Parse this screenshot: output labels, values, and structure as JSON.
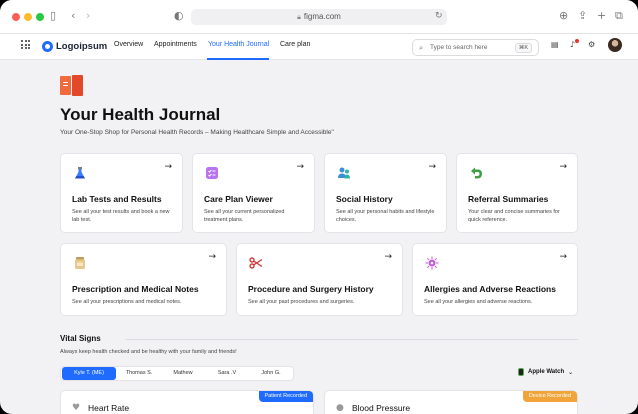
{
  "browser": {
    "url": "figma.com",
    "lock_icon": "lock-icon",
    "colors": {
      "close": "#ff5f57",
      "minimize": "#febc2e",
      "maximize": "#28c840"
    }
  },
  "nav": {
    "logo_text": "Logoipsum",
    "items": [
      {
        "label": "Overview"
      },
      {
        "label": "Appointments"
      },
      {
        "label": "Your Health Journal",
        "active": true
      },
      {
        "label": "Care plan"
      }
    ],
    "search_placeholder": "Type to search here",
    "search_shortcut": "⌘K",
    "accent": "#1f6bff"
  },
  "header": {
    "title": "Your Health Journal",
    "subtitle": "Your One-Stop Shop for Personal Health Records – Making Healthcare Simple and Accessible\""
  },
  "cards": [
    {
      "title": "Lab Tests and Results",
      "desc": "See all your test results and book a new lab test.",
      "icon": "flask-icon"
    },
    {
      "title": "Care Plan Viewer",
      "desc": "See all your current personalized treatment plans.",
      "icon": "checklist-icon"
    },
    {
      "title": "Social History",
      "desc": "See all your personal habits and lifestyle choices.",
      "icon": "people-icon"
    },
    {
      "title": "Referral Summaries",
      "desc": "Your clear and concise summaries for quick reference.",
      "icon": "referral-arrow-icon"
    },
    {
      "title": "Prescription and Medical Notes",
      "desc": "See all your prescriptions and medical notes.",
      "icon": "pill-bottle-icon"
    },
    {
      "title": "Procedure and Surgery History",
      "desc": "See all your past procedures and surgeries.",
      "icon": "scissors-icon"
    },
    {
      "title": "Allergies and Adverse Reactions",
      "desc": "See all your allergies and adverse reactions.",
      "icon": "allergen-icon"
    }
  ],
  "vital_signs": {
    "title": "Vital Signs",
    "subtitle": "Always keep health checked and be healthy with your family and friends!",
    "tabs": [
      {
        "label": "Kyle T. (ME)",
        "active": true
      },
      {
        "label": "Thomas S."
      },
      {
        "label": "Mathew"
      },
      {
        "label": "Sara .V"
      },
      {
        "label": "John G."
      }
    ],
    "device": "Apple Watch",
    "cards": [
      {
        "name": "Heart Rate",
        "badge": "Patient Recorded",
        "badge_color": "#1f6bff",
        "icon": "heart-icon"
      },
      {
        "name": "Blood Pressure",
        "badge": "Device Recorded",
        "badge_color": "#f0a43a",
        "icon": "drop-icon"
      }
    ]
  }
}
